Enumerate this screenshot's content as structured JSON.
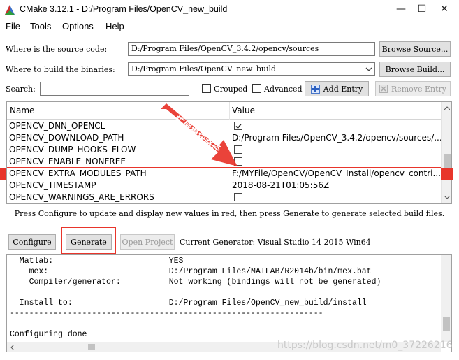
{
  "window": {
    "title": "CMake 3.12.1 - D:/Program Files/OpenCV_new_build",
    "minimize_glyph": "—",
    "maximize_glyph": "☐",
    "close_glyph": "✕"
  },
  "menu": [
    "File",
    "Tools",
    "Options",
    "Help"
  ],
  "source": {
    "label": "Where is the source code:",
    "value": "D:/Program Files/OpenCV_3.4.2/opencv/sources",
    "browse_label": "Browse Source..."
  },
  "build": {
    "label": "Where to build the binaries:",
    "value": "D:/Program Files/OpenCV_new_build",
    "browse_label": "Browse Build..."
  },
  "search": {
    "label": "Search:",
    "value": "",
    "grouped_label": "Grouped",
    "advanced_label": "Advanced",
    "add_entry_label": "Add Entry",
    "remove_entry_label": "Remove Entry"
  },
  "table": {
    "col_name": "Name",
    "col_value": "Value",
    "rows": [
      {
        "name": "OPENCV_DNN_OPENCL",
        "type": "bool",
        "value": "",
        "checked": true
      },
      {
        "name": "OPENCV_DOWNLOAD_PATH",
        "type": "text",
        "value": "D:/Program Files/OpenCV_3.4.2/opencv/sources/..."
      },
      {
        "name": "OPENCV_DUMP_HOOKS_FLOW",
        "type": "bool",
        "value": "",
        "checked": false
      },
      {
        "name": "OPENCV_ENABLE_NONFREE",
        "type": "bool",
        "value": "",
        "checked": false
      },
      {
        "name": "OPENCV_EXTRA_MODULES_PATH",
        "type": "text",
        "value": "F:/MYFile/OpenCV/OpenCV_Install/opencv_contri..."
      },
      {
        "name": "OPENCV_TIMESTAMP",
        "type": "text",
        "value": "2018-08-21T01:05:56Z"
      },
      {
        "name": "OPENCV_WARNINGS_ARE_ERRORS",
        "type": "bool",
        "value": "",
        "checked": false
      }
    ]
  },
  "annotation": {
    "text": "扩展模块路径",
    "color": "#e8352b"
  },
  "status_message": "Press Configure to update and display new values in red, then press Generate to generate selected build files.",
  "buttons": {
    "configure": "Configure",
    "generate": "Generate",
    "open_project": "Open Project"
  },
  "generator_text": "Current Generator: Visual Studio 14 2015 Win64",
  "output_lines": [
    "  Matlab:                        YES",
    "    mex:                         D:/Program Files/MATLAB/R2014b/bin/mex.bat",
    "    Compiler/generator:          Not working (bindings will not be generated)",
    "",
    "  Install to:                    D:/Program Files/OpenCV_new_build/install",
    "-----------------------------------------------------------------",
    "",
    "Configuring done"
  ],
  "watermark": "https://blog.csdn.net/m0_37226216",
  "colors": {
    "highlight_row": "#e8352b",
    "accent": "#e8352b"
  }
}
